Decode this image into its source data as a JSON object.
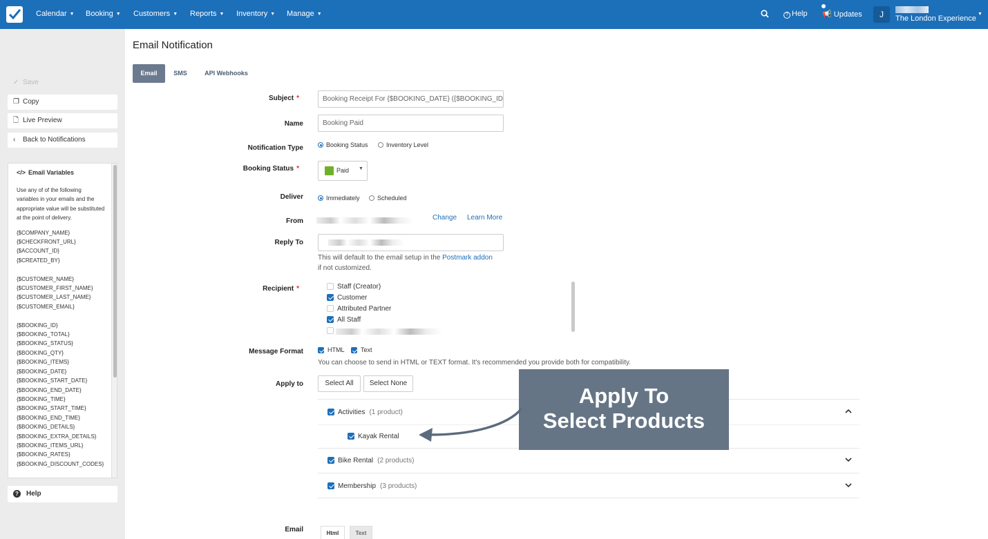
{
  "nav": {
    "items": [
      "Calendar",
      "Booking",
      "Customers",
      "Reports",
      "Inventory",
      "Manage"
    ],
    "help": "Help",
    "updates": "Updates",
    "avatar_initial": "J",
    "account_name": "The London Experience"
  },
  "sidebar": {
    "save": "Save",
    "copy": "Copy",
    "live_preview": "Live Preview",
    "back": "Back to Notifications",
    "vars_title": "Email Variables",
    "vars_desc": "Use any of of the following variables in your emails and the appropriate value will be substituted at the point of delivery.",
    "vars_group1": [
      "{$COMPANY_NAME}",
      "{$CHECKFRONT_URL}",
      "{$ACCOUNT_ID}",
      "{$CREATED_BY}"
    ],
    "vars_group2": [
      "{$CUSTOMER_NAME}",
      "{$CUSTOMER_FIRST_NAME}",
      "{$CUSTOMER_LAST_NAME}",
      "{$CUSTOMER_EMAIL}"
    ],
    "vars_group3": [
      "{$BOOKING_ID}",
      "{$BOOKING_TOTAL}",
      "{$BOOKING_STATUS}",
      "{$BOOKING_QTY}",
      "{$BOOKING_ITEMS}",
      "{$BOOKING_DATE}",
      "{$BOOKING_START_DATE}",
      "{$BOOKING_END_DATE}",
      "{$BOOKING_TIME}",
      "{$BOOKING_START_TIME}",
      "{$BOOKING_END_TIME}",
      "{$BOOKING_DETAILS}",
      "{$BOOKING_EXTRA_DETAILS}",
      "{$BOOKING_ITEMS_URL}",
      "{$BOOKING_RATES}",
      "{$BOOKING_DISCOUNT_CODES}"
    ],
    "help": "Help"
  },
  "page": {
    "title": "Email Notification",
    "tabs": [
      "Email",
      "SMS",
      "API Webhooks"
    ]
  },
  "form": {
    "subject_label": "Subject",
    "subject_value": "Booking Receipt For {$BOOKING_DATE} ({$BOOKING_ID",
    "name_label": "Name",
    "name_value": "Booking Paid",
    "notif_type_label": "Notification Type",
    "notif_type_opts": [
      "Booking Status",
      "Inventory Level"
    ],
    "booking_status_label": "Booking Status",
    "booking_status_value": "Paid",
    "deliver_label": "Deliver",
    "deliver_opts": [
      "Immediately",
      "Scheduled"
    ],
    "from_label": "From",
    "from_change": "Change",
    "from_learn": "Learn More",
    "reply_label": "Reply To",
    "reply_help_1": "This will default to the email setup in the",
    "reply_help_link": "Postmark addon",
    "reply_help_2": "if not customized.",
    "recipient_label": "Recipient",
    "recipients": [
      "Staff (Creator)",
      "Customer",
      "Attributed Partner",
      "All Staff"
    ],
    "format_label": "Message Format",
    "format_opts": [
      "HTML",
      "Text"
    ],
    "format_help": "You can choose to send in HTML or TEXT format. It's recommended you provide both for compatibility.",
    "apply_label": "Apply to",
    "select_all": "Select All",
    "select_none": "Select None",
    "categories": [
      {
        "name": "Activities",
        "count": "(1 product)"
      },
      {
        "name": "Bike Rental",
        "count": "(2 products)"
      },
      {
        "name": "Membership",
        "count": "(3 products)"
      }
    ],
    "product": "Kayak Rental",
    "email_label": "Email",
    "email_tabs": [
      "Html",
      "Text"
    ]
  },
  "callout": {
    "line1": "Apply To",
    "line2": "Select Products"
  }
}
